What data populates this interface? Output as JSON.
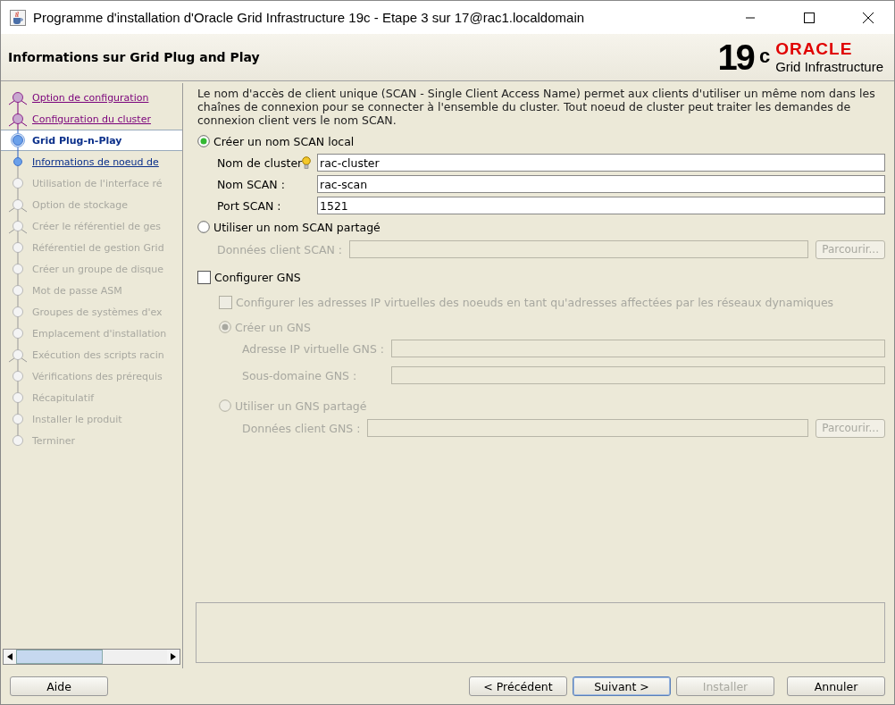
{
  "window": {
    "title": "Programme d'installation d'Oracle Grid Infrastructure 19c - Etape 3 sur 17@rac1.localdomain"
  },
  "header": {
    "title": "Informations sur Grid Plug and Play",
    "logo_version": "19",
    "logo_sup": "c",
    "logo_brand": "ORACLE",
    "logo_product": "Grid Infrastructure"
  },
  "steps": [
    {
      "label": "Option de configuration",
      "visited": true,
      "selected": false,
      "disabled": false,
      "branch": true
    },
    {
      "label": "Configuration du cluster",
      "visited": true,
      "selected": false,
      "disabled": false,
      "branch": true
    },
    {
      "label": "Grid Plug-n-Play",
      "visited": false,
      "selected": true,
      "disabled": false,
      "branch": false
    },
    {
      "label": "Informations de noeud de",
      "visited": false,
      "selected": false,
      "disabled": false,
      "branch": false
    },
    {
      "label": "Utilisation de l'interface ré",
      "visited": false,
      "selected": false,
      "disabled": true,
      "branch": false
    },
    {
      "label": "Option de stockage",
      "visited": false,
      "selected": false,
      "disabled": true,
      "branch": true
    },
    {
      "label": "Créer le référentiel de ges",
      "visited": false,
      "selected": false,
      "disabled": true,
      "branch": true
    },
    {
      "label": "Référentiel de gestion Grid",
      "visited": false,
      "selected": false,
      "disabled": true,
      "branch": false
    },
    {
      "label": "Créer un groupe de disque",
      "visited": false,
      "selected": false,
      "disabled": true,
      "branch": false
    },
    {
      "label": "Mot de passe ASM",
      "visited": false,
      "selected": false,
      "disabled": true,
      "branch": false
    },
    {
      "label": "Groupes de systèmes d'ex",
      "visited": false,
      "selected": false,
      "disabled": true,
      "branch": false
    },
    {
      "label": "Emplacement d'installation",
      "visited": false,
      "selected": false,
      "disabled": true,
      "branch": false
    },
    {
      "label": "Exécution des scripts racin",
      "visited": false,
      "selected": false,
      "disabled": true,
      "branch": true
    },
    {
      "label": "Vérifications des prérequis",
      "visited": false,
      "selected": false,
      "disabled": true,
      "branch": false
    },
    {
      "label": "Récapitulatif",
      "visited": false,
      "selected": false,
      "disabled": true,
      "branch": false
    },
    {
      "label": "Installer le produit",
      "visited": false,
      "selected": false,
      "disabled": true,
      "branch": false
    },
    {
      "label": "Terminer",
      "visited": false,
      "selected": false,
      "disabled": true,
      "branch": false
    }
  ],
  "description": "Le nom d'accès de client unique (SCAN - Single Client Access Name) permet aux clients d'utiliser un même nom dans les chaînes de connexion pour se connecter à l'ensemble du cluster. Tout noeud de cluster peut traiter les demandes de connexion client vers le nom SCAN.",
  "scan_options": [
    {
      "label": "Créer un nom SCAN local",
      "selected": true,
      "fields": [
        {
          "label": "Nom de cluster",
          "value": "rac-cluster",
          "hint": true
        },
        {
          "label": "Nom SCAN :",
          "value": "rac-scan",
          "hint": false
        },
        {
          "label": "Port SCAN :",
          "value": "1521",
          "hint": false
        }
      ]
    },
    {
      "label": "Utiliser un nom SCAN partagé",
      "selected": false,
      "browse_field": {
        "label": "Données client SCAN :",
        "button": "Parcourir..."
      }
    }
  ],
  "gns": {
    "label": "Configurer GNS",
    "checked": false,
    "dynamic_vip": {
      "label": "Configurer les adresses IP virtuelles des noeuds en tant qu'adresses affectées par les réseaux dynamiques",
      "checked": false
    },
    "options": [
      {
        "label": "Créer un GNS",
        "selected": true,
        "fields": [
          {
            "label": "Adresse IP virtuelle GNS :",
            "hint": false
          },
          {
            "label": "Sous-domaine GNS :",
            "hint": false
          }
        ]
      },
      {
        "label": "Utiliser un GNS partagé",
        "selected": false,
        "browse_field": {
          "label": "Données client GNS :",
          "button": "Parcourir..."
        }
      }
    ]
  },
  "buttons": {
    "help": {
      "label": "Aide"
    },
    "actions": [
      {
        "label": "< Précédent",
        "default": false,
        "disabled": false
      },
      {
        "label": "Suivant >",
        "default": true,
        "disabled": false
      },
      {
        "label": "Installer",
        "default": false,
        "disabled": true
      },
      {
        "label": "Annuler",
        "default": false,
        "disabled": false
      }
    ]
  }
}
